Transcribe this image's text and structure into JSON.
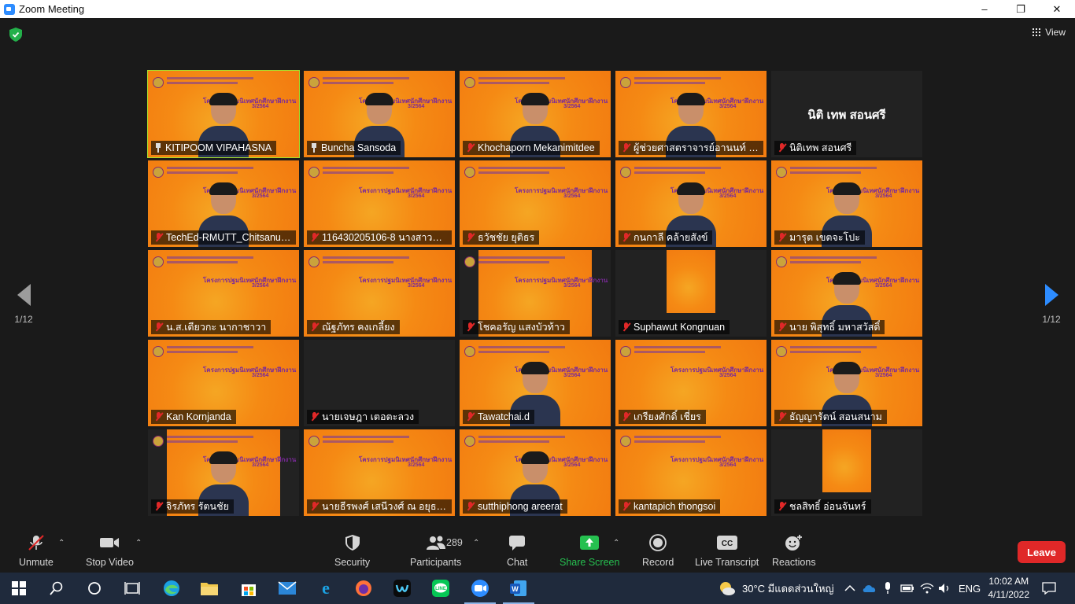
{
  "window": {
    "title": "Zoom Meeting",
    "minimize": "–",
    "restore": "❐",
    "close": "✕"
  },
  "view_label": "View",
  "pager": {
    "prev_label": "1/12",
    "next_label": "1/12"
  },
  "slide": {
    "banner": "โครงการปฐมนิเทศนักศึกษาฝึกงาน",
    "term": "3/2564",
    "time": "TIME\n09:00-12:00\nDATE"
  },
  "participants": [
    {
      "name": "KITIPOOM VIPAHASNA",
      "icon": "pin",
      "style": "slide-person",
      "active": true
    },
    {
      "name": "Buncha Sansoda",
      "icon": "pin",
      "style": "slide-person"
    },
    {
      "name": "Khochaporn Mekanimitdee",
      "icon": "muted",
      "style": "slide-person"
    },
    {
      "name": "ผู้ช่วยศาสตราจารย์อานนท์ นิยม...",
      "icon": "muted",
      "style": "slide-person"
    },
    {
      "name": "นิติเทพ สอนศรี",
      "icon": "muted",
      "style": "dark",
      "big": "นิติ เทพ สอนศรี"
    },
    {
      "name": "TechEd-RMUTT_Chitsanup...",
      "icon": "muted",
      "style": "slide-person"
    },
    {
      "name": "116430205106-8 นางสาววรร...",
      "icon": "muted",
      "style": "slide"
    },
    {
      "name": "ธวัชชัย ยุติธร",
      "icon": "muted",
      "style": "slide"
    },
    {
      "name": "กนกาลี คล้ายสังข์",
      "icon": "muted",
      "style": "slide-person"
    },
    {
      "name": "มารุต เขตจะโปะ",
      "icon": "muted",
      "style": "slide-person"
    },
    {
      "name": "น.ส.เตียวกะ นากาชาวา",
      "icon": "muted",
      "style": "slide"
    },
    {
      "name": "ณัฐภัทร คงเกลี้ยง",
      "icon": "muted",
      "style": "slide"
    },
    {
      "name": "โชคอรัญ แสงบัวท้าว",
      "icon": "muted",
      "style": "narrow"
    },
    {
      "name": "Suphawut Kongnuan",
      "icon": "muted",
      "style": "narrow2"
    },
    {
      "name": "นาย พิสุทธิ์ มหาสวัสดิ์",
      "icon": "muted",
      "style": "slide-person"
    },
    {
      "name": "Kan Kornjanda",
      "icon": "muted",
      "style": "slide"
    },
    {
      "name": "นายเจษฎา เตอตะลวง",
      "icon": "muted",
      "style": "dark"
    },
    {
      "name": "Tawatchai.d",
      "icon": "muted",
      "style": "slide-person"
    },
    {
      "name": "เกรียงศักดิ์ เชี่ยร",
      "icon": "muted",
      "style": "slide"
    },
    {
      "name": "ธัญญารัตน์ สอนสนาม",
      "icon": "muted",
      "style": "slide-person"
    },
    {
      "name": "จิรภัทร รัตนชัย",
      "icon": "muted",
      "style": "narrow-person"
    },
    {
      "name": "นายธีรพงศ์ เสนีวงศ์ ณ อยุธยา",
      "icon": "muted",
      "style": "slide"
    },
    {
      "name": "sutthiphong areerat",
      "icon": "muted",
      "style": "slide-person"
    },
    {
      "name": "kantapich thongsoi",
      "icon": "muted",
      "style": "slide"
    },
    {
      "name": "ชลสิทธิ์ อ่อนจันทร์",
      "icon": "muted",
      "style": "narrow2"
    }
  ],
  "toolbar": {
    "unmute": "Unmute",
    "stop_video": "Stop Video",
    "security": "Security",
    "participants": "Participants",
    "participant_count": "289",
    "chat": "Chat",
    "share_screen": "Share Screen",
    "record": "Record",
    "live_transcript": "Live Transcript",
    "reactions": "Reactions",
    "leave": "Leave",
    "cc": "CC"
  },
  "taskbar": {
    "weather": "30°C  มีแดดส่วนใหญ่",
    "language": "ENG",
    "time": "10:02 AM",
    "date": "4/11/2022"
  },
  "colors": {
    "accent": "#2d8cff",
    "share": "#26c050",
    "leave": "#e02828",
    "active_border": "#a6e22e"
  }
}
